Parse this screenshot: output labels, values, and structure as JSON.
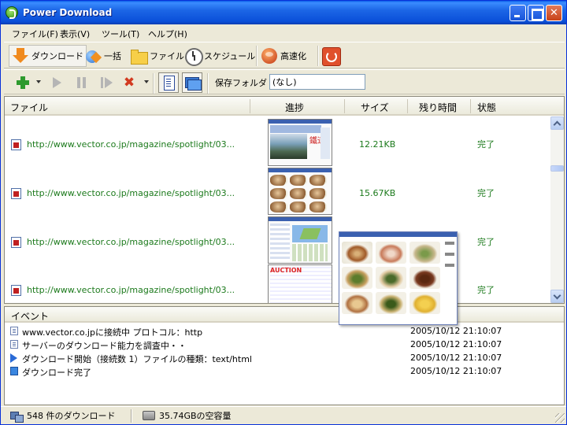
{
  "window": {
    "title": "Power Download"
  },
  "menu": {
    "items": [
      {
        "label": "ファイル(F)"
      },
      {
        "label": "表示(V)"
      },
      {
        "label": "ツール(T)"
      },
      {
        "label": "ヘルプ(H)"
      }
    ]
  },
  "toolbar": {
    "download": "ダウンロード",
    "batch": "一括",
    "file": "ファイル",
    "schedule": "スケジュール",
    "speedup": "高速化"
  },
  "toolbar2": {
    "save_folder_label": "保存フォルダ",
    "save_folder_value": "(なし)"
  },
  "list": {
    "columns": [
      "ファイル",
      "進捗",
      "サイズ",
      "残り時間",
      "状態"
    ],
    "rows": [
      {
        "url": "http://www.vector.co.jp/magazine/spotlight/03...",
        "size": "12.21KB",
        "remaining": "",
        "status": "完了"
      },
      {
        "url": "http://www.vector.co.jp/magazine/spotlight/03...",
        "size": "15.67KB",
        "remaining": "",
        "status": "完了"
      },
      {
        "url": "http://www.vector.co.jp/magazine/spotlight/03...",
        "size": "",
        "remaining": "",
        "status": "完了"
      },
      {
        "url": "http://www.vector.co.jp/magazine/spotlight/03...",
        "size": "",
        "remaining": "",
        "status": "完了"
      }
    ]
  },
  "events": {
    "header": "イベント",
    "rows": [
      {
        "icon": "document-icon",
        "text": "www.vector.co.jpに接続中 プロトコル：http",
        "time": "2005/10/12 21:10:07"
      },
      {
        "icon": "document-icon",
        "text": "サーバーのダウンロード能力を調査中・・",
        "time": "2005/10/12 21:10:07"
      },
      {
        "icon": "play-icon",
        "text": "ダウンロード開始（接続数 1）ファイルの種類：text/html",
        "time": "2005/10/12 21:10:07"
      },
      {
        "icon": "complete-icon",
        "text": "ダウンロード完了",
        "time": "2005/10/12 21:10:07"
      }
    ]
  },
  "statusbar": {
    "download_count": "548 件のダウンロード",
    "free_space": "35.74GBの空容量"
  },
  "thumbnail_text": {
    "auction_label": "AUCTION"
  },
  "colors": {
    "titlebar": "#0a4fd8",
    "link_green": "#1c7a1c",
    "chrome": "#ece9d8"
  }
}
